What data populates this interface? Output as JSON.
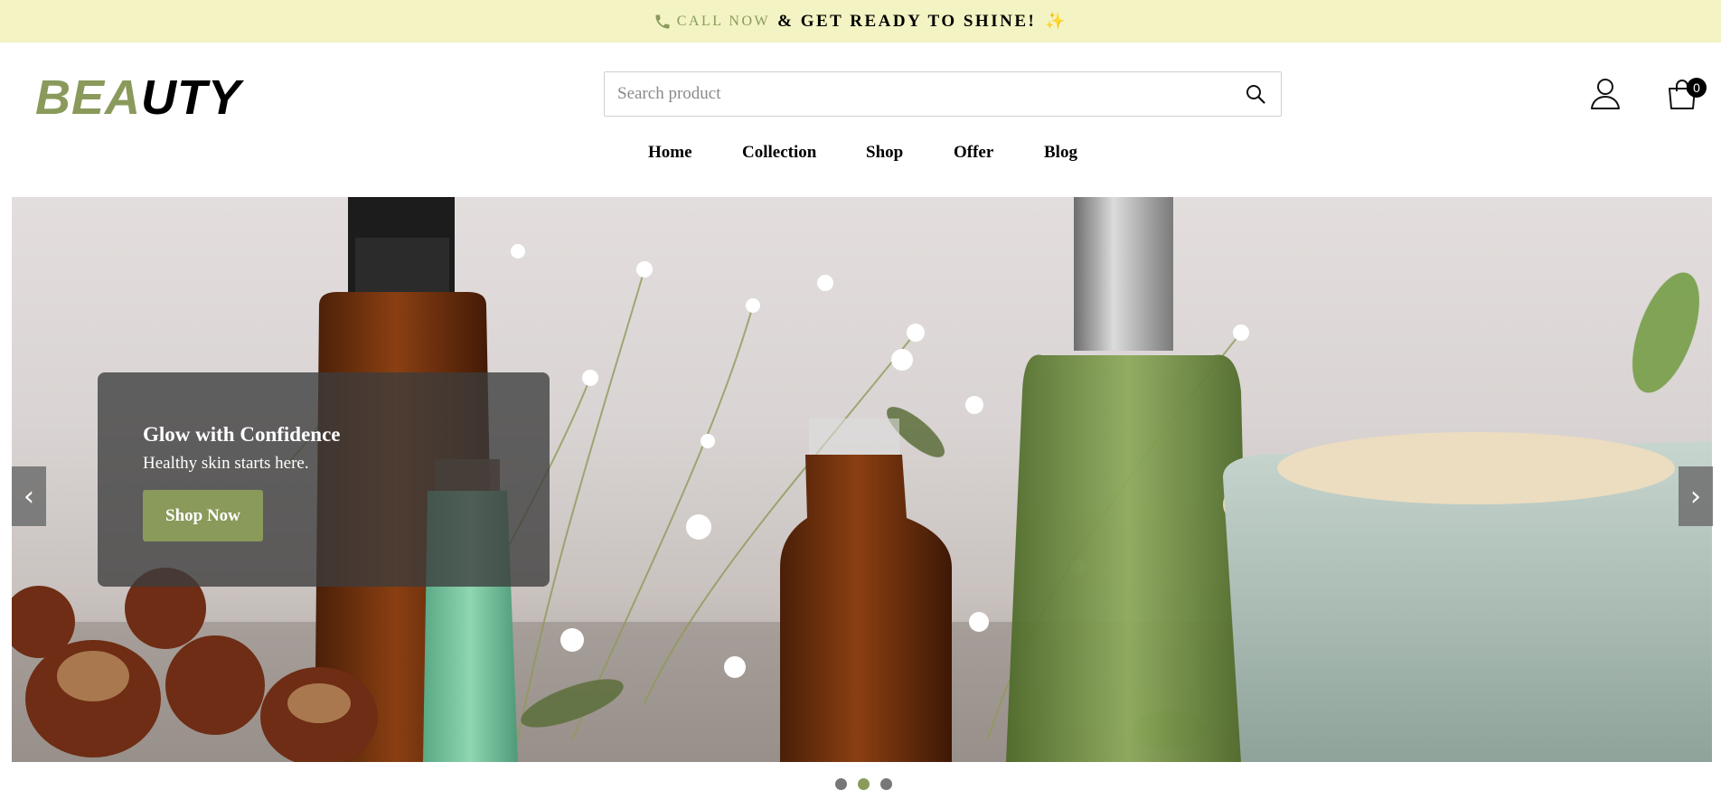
{
  "announcement": {
    "call_label": "CALL NOW",
    "message": "& GET READY TO SHINE!",
    "sparkle": "✨"
  },
  "header": {
    "logo_part1": "BEA",
    "logo_part2": "UTY",
    "search_placeholder": "Search product",
    "cart_count": "0"
  },
  "nav": {
    "home": "Home",
    "collection": "Collection",
    "shop": "Shop",
    "offer": "Offer",
    "blog": "Blog"
  },
  "hero": {
    "title": "Glow with Confidence",
    "subtitle": "Healthy skin starts here.",
    "cta": "Shop Now",
    "prev_arrow": "‹",
    "next_arrow": "›",
    "slide_count": 3,
    "active_slide": 2
  },
  "colors": {
    "accent": "#8a9a5b",
    "announce_bg": "#f3f3c3"
  }
}
